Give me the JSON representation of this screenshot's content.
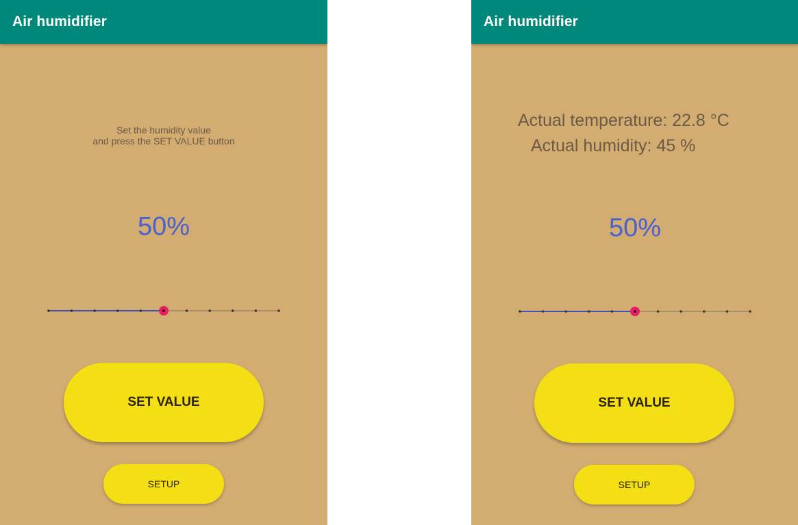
{
  "left_screen": {
    "app_title": "Air humidifier",
    "instruction_line1": "Set the humidity value",
    "instruction_line2": "and press the SET VALUE button",
    "setpoint_text": "50%",
    "slider": {
      "min": 0,
      "max": 100,
      "step": 10,
      "value": 50
    },
    "set_value_label": "SET VALUE",
    "setup_label": "SETUP"
  },
  "right_screen": {
    "app_title": "Air humidifier",
    "actual_temperature_text": "Actual temperature: 22.8 °C",
    "actual_humidity_text": "Actual humidity: 45 %",
    "setpoint_text": "50%",
    "slider": {
      "min": 0,
      "max": 100,
      "step": 10,
      "value": 50
    },
    "set_value_label": "SET VALUE",
    "setup_label": "SETUP"
  },
  "colors": {
    "appbar": "#00897b",
    "background": "#d3ac72",
    "button": "#f3df13",
    "setpoint_text": "#4a5fd0",
    "slider_active": "#3f51b5",
    "slider_thumb": "#e91e63"
  }
}
